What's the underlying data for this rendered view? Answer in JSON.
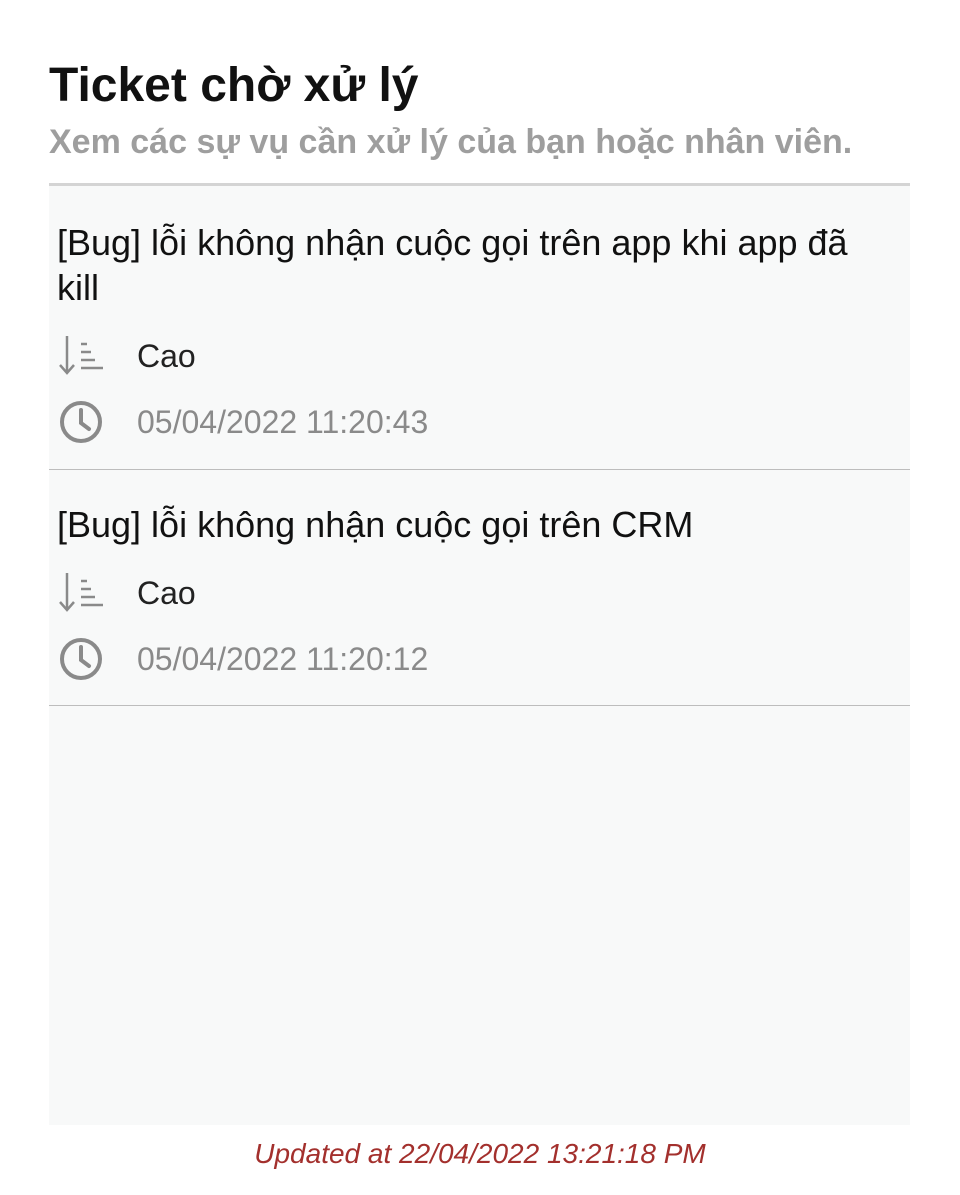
{
  "header": {
    "title": "Ticket chờ xử lý",
    "subtitle": "Xem các sự vụ cần xử lý của bạn hoặc nhân viên."
  },
  "tickets": [
    {
      "name": "[Bug] lỗi không nhận cuộc gọi trên app khi app đã kill",
      "priority": "Cao",
      "priority_icon": "sort-descending-icon",
      "datetime": "05/04/2022 11:20:43",
      "datetime_icon": "clock-icon"
    },
    {
      "name": "[Bug] lỗi không nhận cuộc gọi trên CRM",
      "priority": "Cao",
      "priority_icon": "sort-descending-icon",
      "datetime": "05/04/2022 11:20:12",
      "datetime_icon": "clock-icon"
    }
  ],
  "footer": {
    "updated_text": "Updated at 22/04/2022 13:21:18 PM"
  },
  "colors": {
    "subtitle": "#9e9e9e",
    "panel_bg": "#f8f9f9",
    "footer_text": "#a3302d",
    "icon_gray": "#8a8a8a"
  }
}
